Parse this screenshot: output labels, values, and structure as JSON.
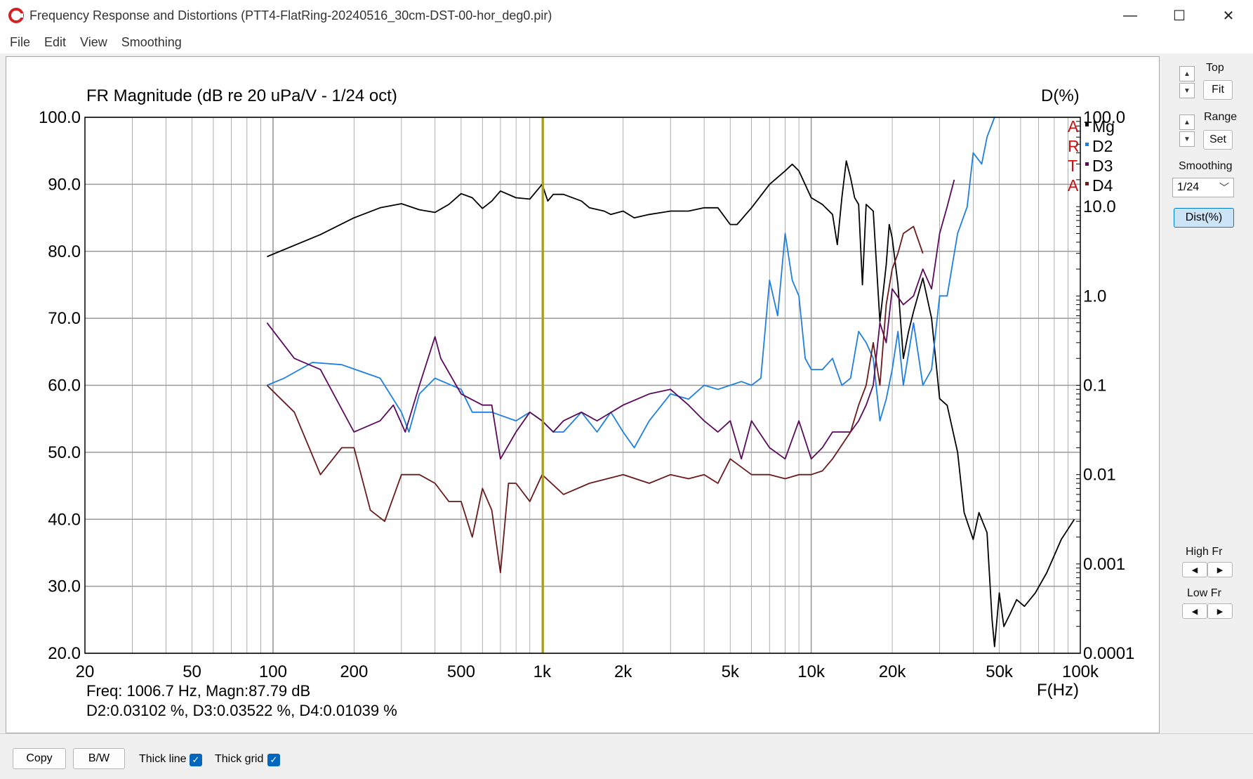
{
  "window": {
    "title": "Frequency Response and Distortions (PTT4-FlatRing-20240516_30cm-DST-00-hor_deg0.pir)",
    "minimize": "—",
    "maximize": "☐",
    "close": "✕"
  },
  "menu": [
    "File",
    "Edit",
    "View",
    "Smoothing"
  ],
  "right_panel": {
    "top_label": "Top",
    "fit_label": "Fit",
    "range_label": "Range",
    "set_label": "Set",
    "smoothing_label": "Smoothing",
    "smoothing_value": "1/24",
    "dist_label": "Dist(%)",
    "high_fr_label": "High Fr",
    "low_fr_label": "Low Fr",
    "up_arrow": "▲",
    "down_arrow": "▼",
    "left_arrow": "◀",
    "right_arrow": "▶"
  },
  "bottom_bar": {
    "copy_label": "Copy",
    "bw_label": "B/W",
    "thick_line_label": "Thick line",
    "thick_grid_label": "Thick grid",
    "thick_line_checked": true,
    "thick_grid_checked": true
  },
  "chart_data": {
    "type": "line",
    "title": "FR Magnitude (dB re 20 uPa/V - 1/24 oct)",
    "right_axis_title": "D(%)",
    "xlabel": "F(Hz)",
    "x_scale": "log",
    "xlim": [
      20,
      100000
    ],
    "ylim": [
      20,
      100
    ],
    "y2_scale": "log",
    "y2lim": [
      0.0001,
      100
    ],
    "x_ticks": [
      {
        "v": 20,
        "label": "20"
      },
      {
        "v": 50,
        "label": "50"
      },
      {
        "v": 100,
        "label": "100"
      },
      {
        "v": 200,
        "label": "200"
      },
      {
        "v": 500,
        "label": "500"
      },
      {
        "v": 1000,
        "label": "1k"
      },
      {
        "v": 2000,
        "label": "2k"
      },
      {
        "v": 5000,
        "label": "5k"
      },
      {
        "v": 10000,
        "label": "10k"
      },
      {
        "v": 20000,
        "label": "20k"
      },
      {
        "v": 50000,
        "label": "50k"
      },
      {
        "v": 100000,
        "label": "100k"
      }
    ],
    "y_ticks": [
      {
        "v": 100,
        "label": "100.0"
      },
      {
        "v": 90,
        "label": "90.0"
      },
      {
        "v": 80,
        "label": "80.0"
      },
      {
        "v": 70,
        "label": "70.0"
      },
      {
        "v": 60,
        "label": "60.0"
      },
      {
        "v": 50,
        "label": "50.0"
      },
      {
        "v": 40,
        "label": "40.0"
      },
      {
        "v": 30,
        "label": "30.0"
      },
      {
        "v": 20,
        "label": "20.0"
      }
    ],
    "y2_ticks": [
      {
        "v": 100,
        "label": "100.0"
      },
      {
        "v": 10,
        "label": "10.0"
      },
      {
        "v": 1,
        "label": "1.0"
      },
      {
        "v": 0.1,
        "label": "0.1"
      },
      {
        "v": 0.01,
        "label": "0.01"
      },
      {
        "v": 0.001,
        "label": "0.001"
      },
      {
        "v": 0.0001,
        "label": "0.0001"
      }
    ],
    "grid": true,
    "legend_position": "top-right",
    "side_letters": [
      "A",
      "R",
      "T",
      "A"
    ],
    "cursor_freq": 1006.7,
    "readout_line1": "Freq: 1006.7 Hz, Magn:87.79 dB",
    "readout_line2": "D2:0.03102 %, D3:0.03522 %, D4:0.01039 %",
    "colors": {
      "Mg": "#000000",
      "D2": "#1e7fe0",
      "D3": "#5a0a5a",
      "D4": "#6a1a1a",
      "cursor": "#a8a020",
      "axis_text_red": "#d01010",
      "grid": "#9a9a9a"
    },
    "series": [
      {
        "name": "Mg",
        "axis": "left",
        "points": [
          [
            95,
            79.2
          ],
          [
            150,
            82.5
          ],
          [
            200,
            85
          ],
          [
            250,
            86.5
          ],
          [
            300,
            87.1
          ],
          [
            350,
            86.2
          ],
          [
            400,
            85.8
          ],
          [
            450,
            87
          ],
          [
            500,
            88.6
          ],
          [
            550,
            88
          ],
          [
            600,
            86.4
          ],
          [
            650,
            87.5
          ],
          [
            700,
            89
          ],
          [
            800,
            88
          ],
          [
            900,
            87.8
          ],
          [
            1000,
            90
          ],
          [
            1050,
            87.5
          ],
          [
            1100,
            88.5
          ],
          [
            1200,
            88.5
          ],
          [
            1400,
            87.5
          ],
          [
            1500,
            86.5
          ],
          [
            1700,
            86
          ],
          [
            1800,
            85.5
          ],
          [
            2000,
            86
          ],
          [
            2200,
            85
          ],
          [
            2500,
            85.5
          ],
          [
            2800,
            85.8
          ],
          [
            3000,
            86
          ],
          [
            3500,
            86
          ],
          [
            4000,
            86.5
          ],
          [
            4500,
            86.5
          ],
          [
            5000,
            84
          ],
          [
            5300,
            84
          ],
          [
            6000,
            86.5
          ],
          [
            7000,
            90
          ],
          [
            8000,
            92
          ],
          [
            8500,
            93
          ],
          [
            9000,
            92
          ],
          [
            10000,
            88
          ],
          [
            11000,
            87
          ],
          [
            12000,
            85.5
          ],
          [
            12500,
            81
          ],
          [
            13000,
            88
          ],
          [
            13500,
            93.5
          ],
          [
            14000,
            91
          ],
          [
            14500,
            88
          ],
          [
            15000,
            87
          ],
          [
            15500,
            75
          ],
          [
            16000,
            87
          ],
          [
            17000,
            86
          ],
          [
            18000,
            69.5
          ],
          [
            19000,
            78
          ],
          [
            19500,
            84
          ],
          [
            20000,
            82
          ],
          [
            21000,
            75
          ],
          [
            22000,
            64
          ],
          [
            23000,
            68
          ],
          [
            24000,
            71
          ],
          [
            26000,
            76
          ],
          [
            28000,
            70
          ],
          [
            30000,
            58
          ],
          [
            32000,
            57
          ],
          [
            35000,
            50
          ],
          [
            37000,
            41
          ],
          [
            40000,
            37
          ],
          [
            42000,
            41
          ],
          [
            45000,
            38
          ],
          [
            47000,
            25
          ],
          [
            48000,
            21
          ],
          [
            50000,
            29
          ],
          [
            52000,
            24
          ],
          [
            55000,
            26
          ],
          [
            58000,
            28
          ],
          [
            62000,
            27
          ],
          [
            68000,
            29
          ],
          [
            75000,
            32
          ],
          [
            85000,
            37
          ],
          [
            95000,
            40
          ]
        ]
      },
      {
        "name": "D2",
        "axis": "right",
        "points": [
          [
            95,
            0.1
          ],
          [
            110,
            0.12
          ],
          [
            140,
            0.18
          ],
          [
            180,
            0.17
          ],
          [
            250,
            0.12
          ],
          [
            300,
            0.05
          ],
          [
            320,
            0.03
          ],
          [
            350,
            0.08
          ],
          [
            400,
            0.12
          ],
          [
            500,
            0.09
          ],
          [
            550,
            0.05
          ],
          [
            650,
            0.05
          ],
          [
            800,
            0.04
          ],
          [
            900,
            0.05
          ],
          [
            1000,
            0.04
          ],
          [
            1100,
            0.03
          ],
          [
            1200,
            0.03
          ],
          [
            1400,
            0.05
          ],
          [
            1600,
            0.03
          ],
          [
            1800,
            0.05
          ],
          [
            2000,
            0.03
          ],
          [
            2200,
            0.02
          ],
          [
            2500,
            0.04
          ],
          [
            3000,
            0.08
          ],
          [
            3500,
            0.07
          ],
          [
            4000,
            0.1
          ],
          [
            4500,
            0.09
          ],
          [
            5000,
            0.1
          ],
          [
            5500,
            0.11
          ],
          [
            6000,
            0.1
          ],
          [
            6500,
            0.12
          ],
          [
            7000,
            1.5
          ],
          [
            7500,
            0.6
          ],
          [
            8000,
            5
          ],
          [
            8500,
            1.5
          ],
          [
            9000,
            1
          ],
          [
            9500,
            0.2
          ],
          [
            10000,
            0.15
          ],
          [
            11000,
            0.15
          ],
          [
            12000,
            0.2
          ],
          [
            13000,
            0.1
          ],
          [
            14000,
            0.12
          ],
          [
            15000,
            0.4
          ],
          [
            16000,
            0.3
          ],
          [
            17000,
            0.2
          ],
          [
            18000,
            0.04
          ],
          [
            19000,
            0.07
          ],
          [
            20000,
            0.15
          ],
          [
            21000,
            0.4
          ],
          [
            22000,
            0.1
          ],
          [
            24000,
            0.5
          ],
          [
            26000,
            0.1
          ],
          [
            28000,
            0.15
          ],
          [
            30000,
            1
          ],
          [
            32000,
            1
          ],
          [
            35000,
            5
          ],
          [
            38000,
            10
          ],
          [
            40000,
            40
          ],
          [
            43000,
            30
          ],
          [
            45000,
            60
          ],
          [
            48000,
            1500
          ]
        ]
      },
      {
        "name": "D3",
        "axis": "right",
        "points": [
          [
            95,
            0.5
          ],
          [
            120,
            0.2
          ],
          [
            150,
            0.15
          ],
          [
            200,
            0.03
          ],
          [
            250,
            0.04
          ],
          [
            280,
            0.06
          ],
          [
            310,
            0.03
          ],
          [
            350,
            0.1
          ],
          [
            400,
            0.35
          ],
          [
            420,
            0.2
          ],
          [
            500,
            0.08
          ],
          [
            600,
            0.06
          ],
          [
            650,
            0.06
          ],
          [
            700,
            0.015
          ],
          [
            800,
            0.03
          ],
          [
            900,
            0.05
          ],
          [
            1000,
            0.04
          ],
          [
            1100,
            0.03
          ],
          [
            1200,
            0.04
          ],
          [
            1400,
            0.05
          ],
          [
            1600,
            0.04
          ],
          [
            2000,
            0.06
          ],
          [
            2500,
            0.08
          ],
          [
            3000,
            0.09
          ],
          [
            3500,
            0.06
          ],
          [
            4000,
            0.04
          ],
          [
            4500,
            0.03
          ],
          [
            5000,
            0.04
          ],
          [
            5500,
            0.015
          ],
          [
            6000,
            0.04
          ],
          [
            7000,
            0.02
          ],
          [
            8000,
            0.015
          ],
          [
            9000,
            0.04
          ],
          [
            10000,
            0.015
          ],
          [
            11000,
            0.02
          ],
          [
            12000,
            0.03
          ],
          [
            14000,
            0.03
          ],
          [
            15000,
            0.04
          ],
          [
            16000,
            0.06
          ],
          [
            17000,
            0.1
          ],
          [
            18000,
            0.5
          ],
          [
            19000,
            0.3
          ],
          [
            20000,
            1.2
          ],
          [
            22000,
            0.8
          ],
          [
            24000,
            1
          ],
          [
            26000,
            2
          ],
          [
            28000,
            1.2
          ],
          [
            30000,
            5
          ],
          [
            32000,
            10
          ],
          [
            34000,
            20
          ]
        ]
      },
      {
        "name": "D4",
        "axis": "right",
        "points": [
          [
            95,
            0.1
          ],
          [
            120,
            0.05
          ],
          [
            150,
            0.01
          ],
          [
            180,
            0.02
          ],
          [
            200,
            0.02
          ],
          [
            230,
            0.004
          ],
          [
            260,
            0.003
          ],
          [
            300,
            0.01
          ],
          [
            350,
            0.01
          ],
          [
            400,
            0.008
          ],
          [
            450,
            0.005
          ],
          [
            500,
            0.005
          ],
          [
            550,
            0.002
          ],
          [
            600,
            0.007
          ],
          [
            650,
            0.004
          ],
          [
            700,
            0.0008
          ],
          [
            750,
            0.008
          ],
          [
            800,
            0.008
          ],
          [
            900,
            0.005
          ],
          [
            1000,
            0.01
          ],
          [
            1200,
            0.006
          ],
          [
            1500,
            0.008
          ],
          [
            2000,
            0.01
          ],
          [
            2500,
            0.008
          ],
          [
            3000,
            0.01
          ],
          [
            3500,
            0.009
          ],
          [
            4000,
            0.01
          ],
          [
            4500,
            0.008
          ],
          [
            5000,
            0.015
          ],
          [
            6000,
            0.01
          ],
          [
            7000,
            0.01
          ],
          [
            8000,
            0.009
          ],
          [
            9000,
            0.01
          ],
          [
            10000,
            0.01
          ],
          [
            11000,
            0.011
          ],
          [
            12000,
            0.015
          ],
          [
            14000,
            0.03
          ],
          [
            15000,
            0.06
          ],
          [
            16000,
            0.1
          ],
          [
            17000,
            0.3
          ],
          [
            18000,
            0.1
          ],
          [
            19000,
            0.8
          ],
          [
            20000,
            2
          ],
          [
            21000,
            3
          ],
          [
            22000,
            5
          ],
          [
            24000,
            6
          ],
          [
            26000,
            3
          ]
        ]
      }
    ]
  }
}
